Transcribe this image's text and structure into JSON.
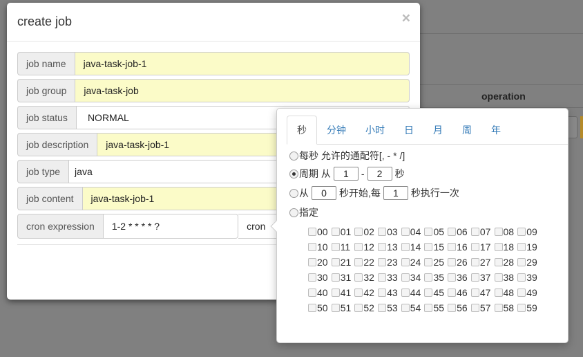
{
  "background": {
    "column_header": "operation"
  },
  "modal": {
    "title": "create job",
    "close_symbol": "×",
    "fields": [
      {
        "label": "job name",
        "value": "java-task-job-1"
      },
      {
        "label": "job group",
        "value": "java-task-job"
      },
      {
        "label": "job status",
        "value": "NORMAL"
      },
      {
        "label": "job description",
        "value": "java-task-job-1"
      },
      {
        "label": "job type",
        "value": "java"
      },
      {
        "label": "job content",
        "value": "java-task-job-1"
      }
    ],
    "cron": {
      "label": "cron expression",
      "value": "1-2 * * * * ?",
      "button_label": "cron"
    }
  },
  "popover": {
    "tabs": [
      "秒",
      "分钟",
      "小时",
      "日",
      "月",
      "周",
      "年"
    ],
    "active_tab": "秒",
    "options": {
      "every": "每秒 允许的通配符[, - * /]",
      "period_prefix": "周期 从",
      "period_from": "1",
      "period_sep": "-",
      "period_to": "2",
      "period_unit": "秒",
      "from_prefix": "从",
      "from_start": "0",
      "from_mid": "秒开始,每",
      "from_every": "1",
      "from_suffix": "秒执行一次",
      "specify": "指定"
    },
    "selected_option": "period",
    "seconds": [
      "00",
      "01",
      "02",
      "03",
      "04",
      "05",
      "06",
      "07",
      "08",
      "09",
      "10",
      "11",
      "12",
      "13",
      "14",
      "15",
      "16",
      "17",
      "18",
      "19",
      "20",
      "21",
      "22",
      "23",
      "24",
      "25",
      "26",
      "27",
      "28",
      "29",
      "30",
      "31",
      "32",
      "33",
      "34",
      "35",
      "36",
      "37",
      "38",
      "39",
      "40",
      "41",
      "42",
      "43",
      "44",
      "45",
      "46",
      "47",
      "48",
      "49",
      "50",
      "51",
      "52",
      "53",
      "54",
      "55",
      "56",
      "57",
      "58",
      "59"
    ]
  }
}
